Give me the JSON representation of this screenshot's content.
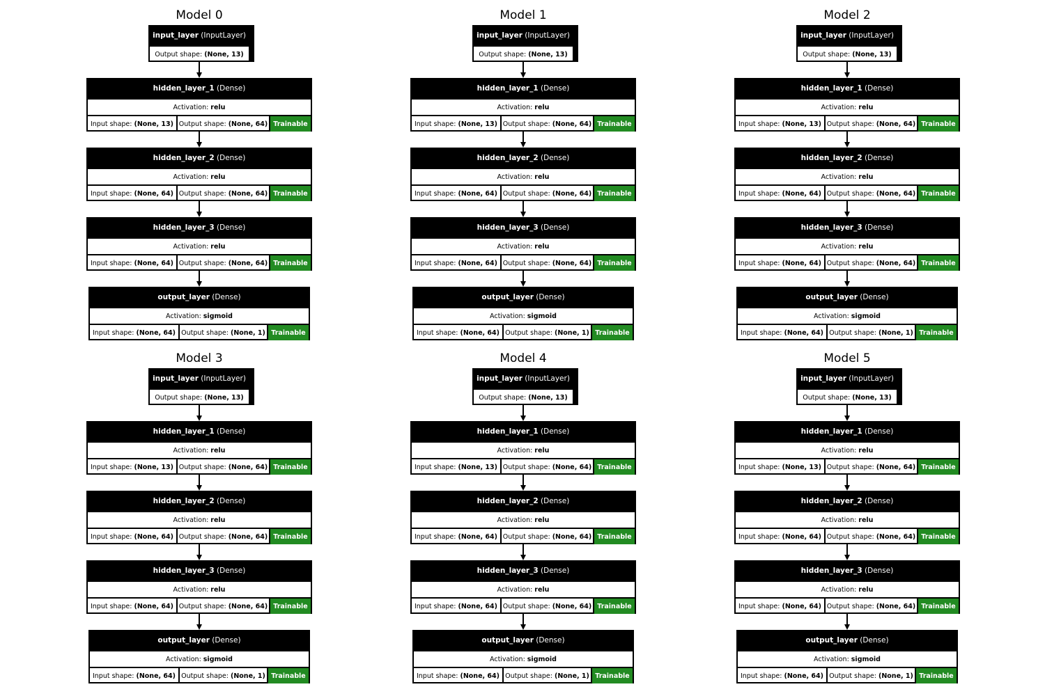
{
  "labels": {
    "output_shape": "Output shape:",
    "input_shape": "Input shape:",
    "activation": "Activation:",
    "trainable": "Trainable"
  },
  "models": [
    {
      "title": "Model 0",
      "layers": [
        {
          "name": "input_layer",
          "type": "(InputLayer)",
          "output_shape": "(None, 13)"
        },
        {
          "name": "hidden_layer_1",
          "type": "(Dense)",
          "activation": "relu",
          "input_shape": "(None, 13)",
          "output_shape": "(None, 64)",
          "trainable": true
        },
        {
          "name": "hidden_layer_2",
          "type": "(Dense)",
          "activation": "relu",
          "input_shape": "(None, 64)",
          "output_shape": "(None, 64)",
          "trainable": true
        },
        {
          "name": "hidden_layer_3",
          "type": "(Dense)",
          "activation": "relu",
          "input_shape": "(None, 64)",
          "output_shape": "(None, 64)",
          "trainable": true
        },
        {
          "name": "output_layer",
          "type": "(Dense)",
          "activation": "sigmoid",
          "input_shape": "(None, 64)",
          "output_shape": "(None, 1)",
          "trainable": true
        }
      ]
    },
    {
      "title": "Model 1",
      "layers": [
        {
          "name": "input_layer",
          "type": "(InputLayer)",
          "output_shape": "(None, 13)"
        },
        {
          "name": "hidden_layer_1",
          "type": "(Dense)",
          "activation": "relu",
          "input_shape": "(None, 13)",
          "output_shape": "(None, 64)",
          "trainable": true
        },
        {
          "name": "hidden_layer_2",
          "type": "(Dense)",
          "activation": "relu",
          "input_shape": "(None, 64)",
          "output_shape": "(None, 64)",
          "trainable": true
        },
        {
          "name": "hidden_layer_3",
          "type": "(Dense)",
          "activation": "relu",
          "input_shape": "(None, 64)",
          "output_shape": "(None, 64)",
          "trainable": true
        },
        {
          "name": "output_layer",
          "type": "(Dense)",
          "activation": "sigmoid",
          "input_shape": "(None, 64)",
          "output_shape": "(None, 1)",
          "trainable": true
        }
      ]
    },
    {
      "title": "Model 2",
      "layers": [
        {
          "name": "input_layer",
          "type": "(InputLayer)",
          "output_shape": "(None, 13)"
        },
        {
          "name": "hidden_layer_1",
          "type": "(Dense)",
          "activation": "relu",
          "input_shape": "(None, 13)",
          "output_shape": "(None, 64)",
          "trainable": true
        },
        {
          "name": "hidden_layer_2",
          "type": "(Dense)",
          "activation": "relu",
          "input_shape": "(None, 64)",
          "output_shape": "(None, 64)",
          "trainable": true
        },
        {
          "name": "hidden_layer_3",
          "type": "(Dense)",
          "activation": "relu",
          "input_shape": "(None, 64)",
          "output_shape": "(None, 64)",
          "trainable": true
        },
        {
          "name": "output_layer",
          "type": "(Dense)",
          "activation": "sigmoid",
          "input_shape": "(None, 64)",
          "output_shape": "(None, 1)",
          "trainable": true
        }
      ]
    },
    {
      "title": "Model 3",
      "layers": [
        {
          "name": "input_layer",
          "type": "(InputLayer)",
          "output_shape": "(None, 13)"
        },
        {
          "name": "hidden_layer_1",
          "type": "(Dense)",
          "activation": "relu",
          "input_shape": "(None, 13)",
          "output_shape": "(None, 64)",
          "trainable": true
        },
        {
          "name": "hidden_layer_2",
          "type": "(Dense)",
          "activation": "relu",
          "input_shape": "(None, 64)",
          "output_shape": "(None, 64)",
          "trainable": true
        },
        {
          "name": "hidden_layer_3",
          "type": "(Dense)",
          "activation": "relu",
          "input_shape": "(None, 64)",
          "output_shape": "(None, 64)",
          "trainable": true
        },
        {
          "name": "output_layer",
          "type": "(Dense)",
          "activation": "sigmoid",
          "input_shape": "(None, 64)",
          "output_shape": "(None, 1)",
          "trainable": true
        }
      ]
    },
    {
      "title": "Model 4",
      "layers": [
        {
          "name": "input_layer",
          "type": "(InputLayer)",
          "output_shape": "(None, 13)"
        },
        {
          "name": "hidden_layer_1",
          "type": "(Dense)",
          "activation": "relu",
          "input_shape": "(None, 13)",
          "output_shape": "(None, 64)",
          "trainable": true
        },
        {
          "name": "hidden_layer_2",
          "type": "(Dense)",
          "activation": "relu",
          "input_shape": "(None, 64)",
          "output_shape": "(None, 64)",
          "trainable": true
        },
        {
          "name": "hidden_layer_3",
          "type": "(Dense)",
          "activation": "relu",
          "input_shape": "(None, 64)",
          "output_shape": "(None, 64)",
          "trainable": true
        },
        {
          "name": "output_layer",
          "type": "(Dense)",
          "activation": "sigmoid",
          "input_shape": "(None, 64)",
          "output_shape": "(None, 1)",
          "trainable": true
        }
      ]
    },
    {
      "title": "Model 5",
      "layers": [
        {
          "name": "input_layer",
          "type": "(InputLayer)",
          "output_shape": "(None, 13)"
        },
        {
          "name": "hidden_layer_1",
          "type": "(Dense)",
          "activation": "relu",
          "input_shape": "(None, 13)",
          "output_shape": "(None, 64)",
          "trainable": true
        },
        {
          "name": "hidden_layer_2",
          "type": "(Dense)",
          "activation": "relu",
          "input_shape": "(None, 64)",
          "output_shape": "(None, 64)",
          "trainable": true
        },
        {
          "name": "hidden_layer_3",
          "type": "(Dense)",
          "activation": "relu",
          "input_shape": "(None, 64)",
          "output_shape": "(None, 64)",
          "trainable": true
        },
        {
          "name": "output_layer",
          "type": "(Dense)",
          "activation": "sigmoid",
          "input_shape": "(None, 64)",
          "output_shape": "(None, 1)",
          "trainable": true
        }
      ]
    }
  ]
}
